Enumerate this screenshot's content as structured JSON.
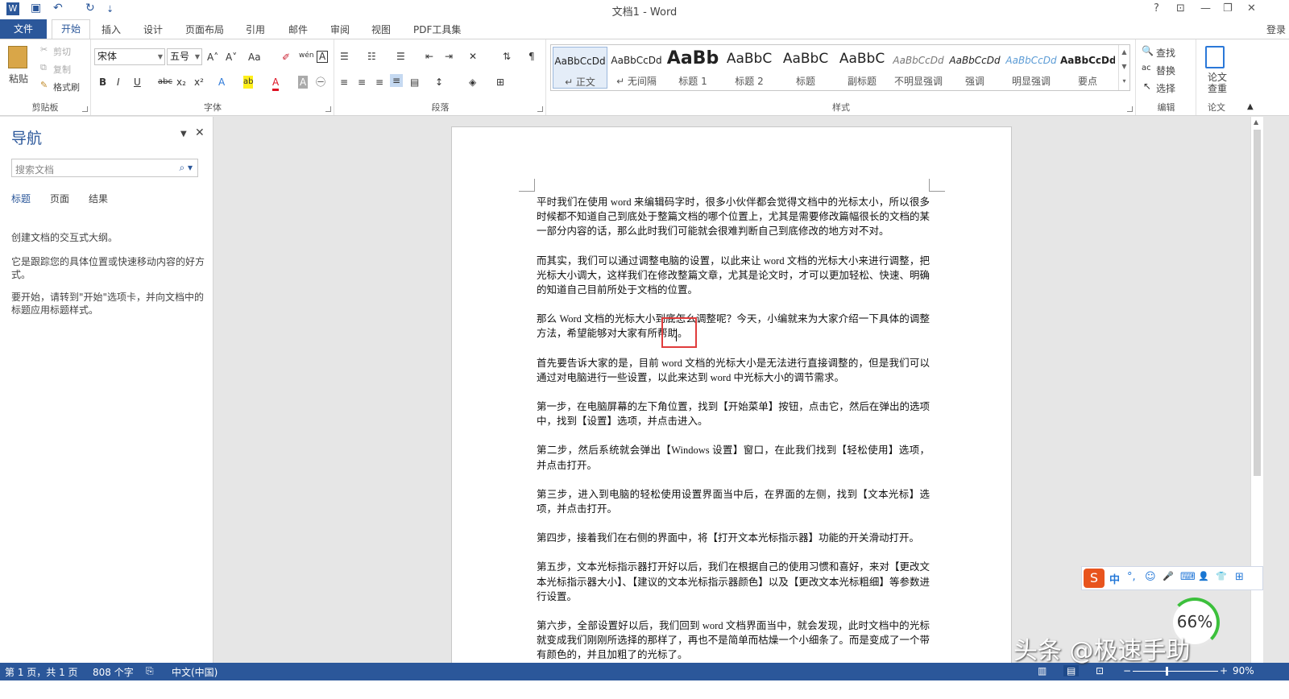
{
  "window": {
    "title": "文档1 - Word",
    "controls": {
      "help": "?",
      "ribbon_opts": "⊡",
      "minimize": "—",
      "restore": "❐",
      "close": "✕"
    }
  },
  "quick_access": {
    "undo": "↶",
    "redo": "↻",
    "customize": "⇣"
  },
  "tabs": [
    "文件",
    "开始",
    "插入",
    "设计",
    "页面布局",
    "引用",
    "邮件",
    "审阅",
    "视图",
    "PDF工具集"
  ],
  "login": "登录",
  "ribbon": {
    "clipboard": {
      "label": "剪贴板",
      "paste": "粘贴",
      "cut": "剪切",
      "copy": "复制",
      "format_painter": "格式刷"
    },
    "font": {
      "label": "字体",
      "font_name": "宋体",
      "font_size": "五号",
      "grow": "A˄",
      "shrink": "A˅",
      "case": "Aa",
      "clear": "✐",
      "phonetic": "wén",
      "border": "A",
      "bold": "B",
      "italic": "I",
      "underline": "U",
      "strike": "abc",
      "sub": "x₂",
      "sup": "x²",
      "effects": "A",
      "highlight": "ab",
      "color": "A",
      "shade": "A",
      "enclose": "㊀"
    },
    "paragraph": {
      "label": "段落"
    },
    "styles": {
      "label": "样式",
      "items": [
        {
          "preview": "AaBbCcDd",
          "name": "↵ 正文"
        },
        {
          "preview": "AaBbCcDd",
          "name": "↵ 无间隔"
        },
        {
          "preview": "AaBb",
          "name": "标题 1"
        },
        {
          "preview": "AaBbC",
          "name": "标题 2"
        },
        {
          "preview": "AaBbC",
          "name": "标题"
        },
        {
          "preview": "AaBbC",
          "name": "副标题"
        },
        {
          "preview": "AaBbCcDd",
          "name": "不明显强调"
        },
        {
          "preview": "AaBbCcDd",
          "name": "强调"
        },
        {
          "preview": "AaBbCcDd",
          "name": "明显强调"
        },
        {
          "preview": "AaBbCcDd",
          "name": "要点"
        }
      ]
    },
    "editing": {
      "label": "编辑",
      "find": "查找",
      "replace": "替换",
      "select": "选择"
    },
    "paper": {
      "label": "论文",
      "check": "论文查重"
    }
  },
  "nav": {
    "title": "导航",
    "search_placeholder": "搜索文档",
    "tabs": [
      "标题",
      "页面",
      "结果"
    ],
    "text1": "创建文档的交互式大纲。",
    "text2": "它是跟踪您的具体位置或快速移动内容的好方式。",
    "text3": "要开始，请转到\"开始\"选项卡，并向文档中的标题应用标题样式。"
  },
  "document": {
    "paragraphs": [
      "平时我们在使用 word 来编辑码字时，很多小伙伴都会觉得文档中的光标太小，所以很多时候都不知道自己到底处于整篇文档的哪个位置上，尤其是需要修改篇幅很长的文档的某一部分内容的话，那么此时我们可能就会很难判断自己到底修改的地方对不对。",
      "而其实，我们可以通过调整电脑的设置，以此来让 word 文档的光标大小来进行调整，把光标大小调大，这样我们在修改整篇文章，尤其是论文时，才可以更加轻松、快速、明确的知道自己目前所处于文档的位置。",
      "那么 Word 文档的光标大小到底怎么调整呢？今天，小编就来为大家介绍一下具体的调整方法，希望能够对大家有所帮助。",
      "首先要告诉大家的是，目前 word 文档的光标大小是无法进行直接调整的，但是我们可以通过对电脑进行一些设置，以此来达到 word 中光标大小的调节需求。",
      "第一步，在电脑屏幕的左下角位置，找到【开始菜单】按钮，点击它，然后在弹出的选项中，找到【设置】选项，并点击进入。",
      "第二步，然后系统就会弹出【Windows 设置】窗口，在此我们找到【轻松使用】选项，并点击打开。",
      "第三步，进入到电脑的轻松使用设置界面当中后，在界面的左侧，找到【文本光标】选项，并点击打开。",
      "第四步，接着我们在右侧的界面中，将【打开文本光标指示器】功能的开关滑动打开。",
      "第五步，文本光标指示器打开好以后，我们在根据自己的使用习惯和喜好，来对【更改文本光标指示器大小】、【建议的文本光标指示器颜色】以及【更改文本光标粗细】等参数进行设置。",
      "第六步，全部设置好以后，我们回到 word 文档界面当中，就会发现，此时文档中的光标就变成我们刚刚所选择的那样了，再也不是简单而枯燥一个小细条了。而是变成了一个带有颜色的，并且加粗了的光标了。"
    ]
  },
  "status": {
    "page": "第 1 页，共 1 页",
    "words": "808 个字",
    "lang": "中文(中国)",
    "zoom": "90%",
    "zoom_minus": "−",
    "zoom_plus": "+"
  },
  "ime": {
    "logo": "S",
    "items": [
      "中",
      "°,",
      "☺",
      "🎤",
      "⌨",
      "👤",
      "👕",
      "⊞"
    ]
  },
  "overlay": {
    "percent": "66%",
    "watermark": "头条 @极速手助"
  }
}
